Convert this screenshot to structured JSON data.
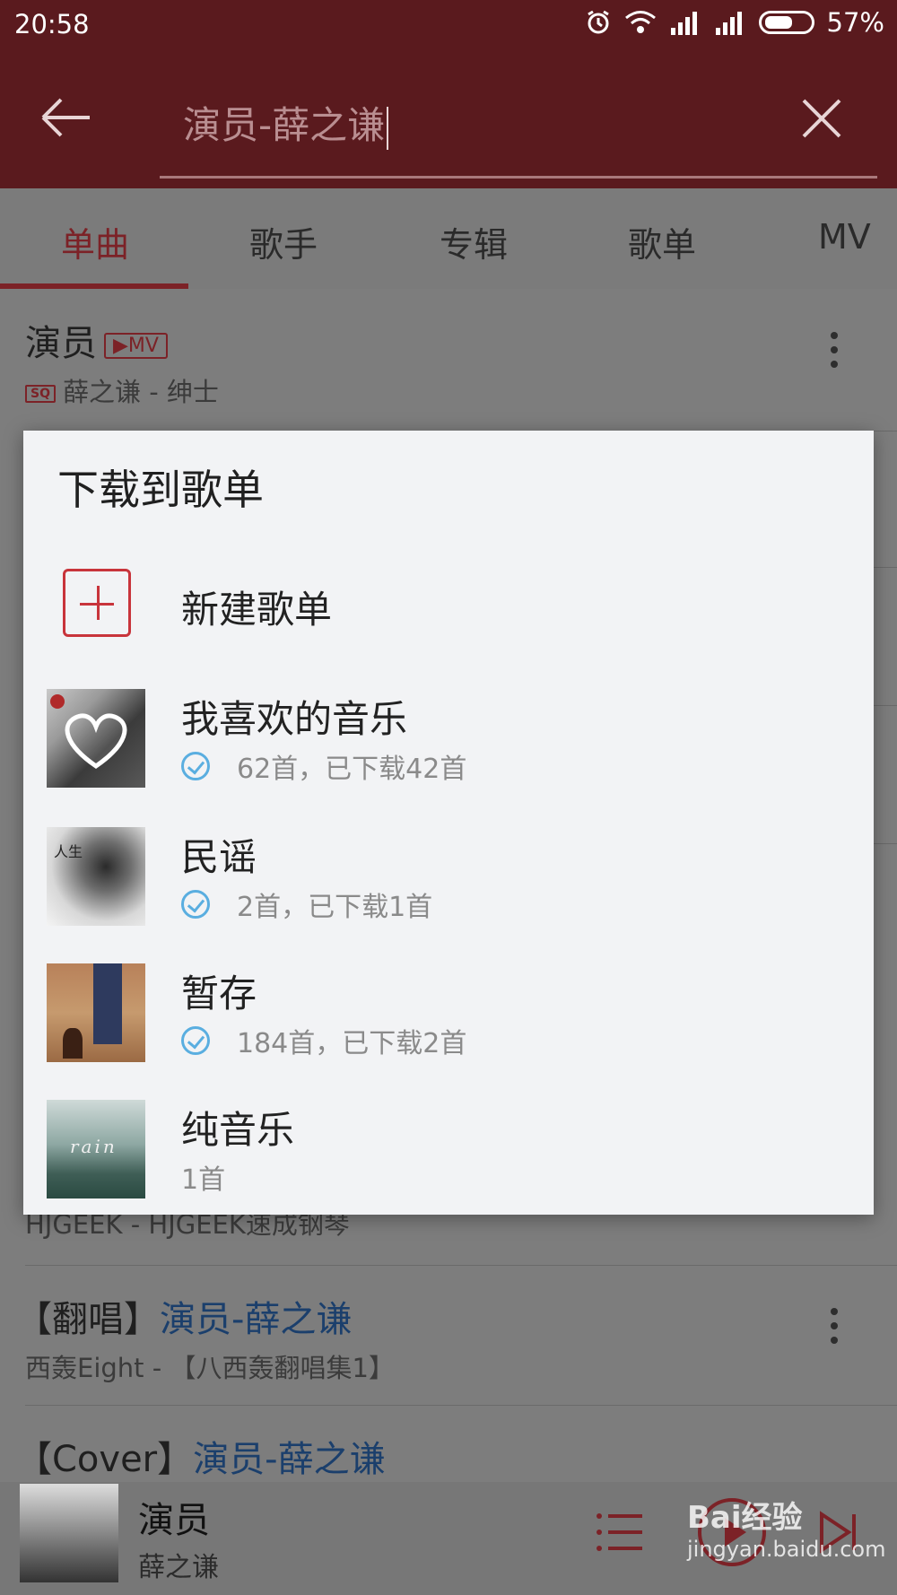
{
  "status_bar": {
    "time": "20:58",
    "battery": "57%",
    "battery_level": 0.57
  },
  "search": {
    "query": "演员-薛之谦"
  },
  "tabs": [
    {
      "label": "单曲",
      "active": true
    },
    {
      "label": "歌手"
    },
    {
      "label": "专辑"
    },
    {
      "label": "歌单"
    },
    {
      "label": "MV"
    }
  ],
  "results": {
    "first": {
      "title": "演员",
      "badge": "▶MV",
      "quality": "SQ",
      "subtitle": "薛之谦 - 绅士"
    },
    "partial_sub": "HJGEEK - HJGEEK速成钢琴",
    "second": {
      "prefix": "【翻唱】",
      "highlight": "演员-薛之谦",
      "subtitle": "西轰Eight - 【八西轰翻唱集1】"
    },
    "third": {
      "prefix": "【Cover】",
      "highlight": "演员-薛之谦"
    }
  },
  "dialog": {
    "title": "下载到歌单",
    "new_playlist": "新建歌单",
    "playlists": [
      {
        "name": "我喜欢的音乐",
        "info": "62首，已下载42首",
        "downloaded": true
      },
      {
        "name": "民谣",
        "info": "2首，已下载1首",
        "downloaded": true
      },
      {
        "name": "暂存",
        "info": "184首，已下载2首",
        "downloaded": true
      },
      {
        "name": "纯音乐",
        "info": "1首",
        "downloaded": false
      }
    ],
    "thumb_texts": {
      "folk": "人生",
      "rain": "rain"
    }
  },
  "player": {
    "title": "演员",
    "artist": "薛之谦"
  },
  "watermark": {
    "brand": "Bai经验",
    "url": "jingyan.baidu.com"
  },
  "colors": {
    "header": "#5a1a1e",
    "accent": "#c8343b",
    "check": "#5aaee0"
  }
}
